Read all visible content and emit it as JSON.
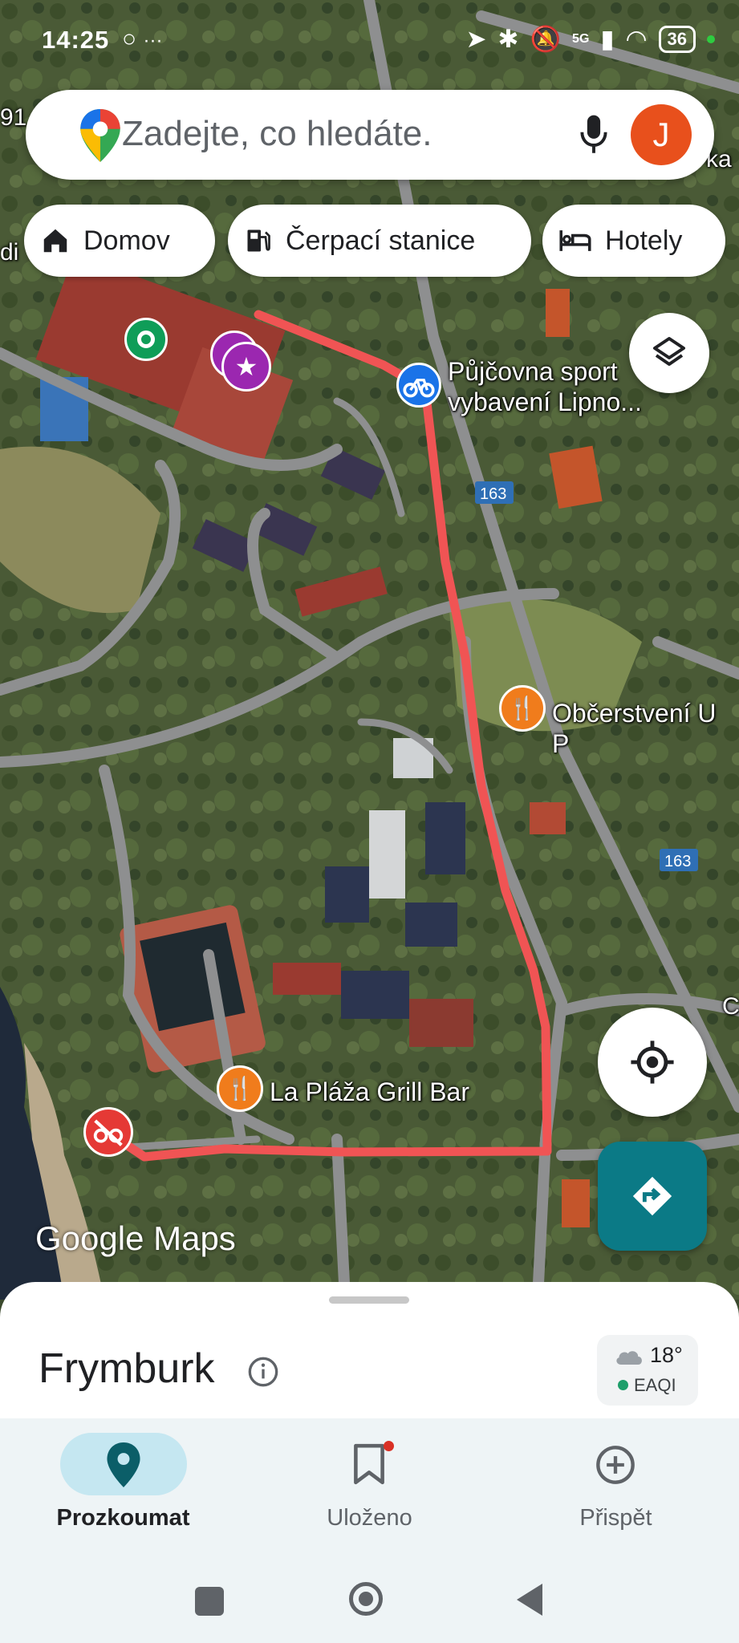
{
  "status_bar": {
    "time": "14:25",
    "battery": "36",
    "network": "5G"
  },
  "search": {
    "placeholder": "Zadejte, co hledáte.",
    "avatar_letter": "J"
  },
  "chips": [
    {
      "label": "Domov",
      "icon": "home-icon"
    },
    {
      "label": "Čerpací stanice",
      "icon": "gas-station-icon"
    },
    {
      "label": "Hotely",
      "icon": "hotel-bed-icon"
    }
  ],
  "map": {
    "labels": {
      "bike_rental": "Půjčovna sportovního vybavení Lipno...",
      "bike_rental_line1": "Půjčovna sport",
      "bike_rental_line2": "vybavení Lipno...",
      "snack": "Občerstvení U P",
      "grill_bar": "La Pláža Grill Bar",
      "road_number": "163",
      "edge_left_top": "91",
      "edge_left_chip": "di",
      "edge_right_top": "ka",
      "edge_right_mid": "C"
    },
    "route_color": "#f05454",
    "watermark": "Google Maps"
  },
  "place": {
    "title": "Frymburk",
    "weather_temp": "18°",
    "air_quality": "EAQI"
  },
  "bottom_nav": [
    {
      "label": "Prozkoumat",
      "icon": "explore-pin-icon",
      "active": true
    },
    {
      "label": "Uloženo",
      "icon": "bookmark-icon",
      "active": false
    },
    {
      "label": "Přispět",
      "icon": "add-circle-icon",
      "active": false
    }
  ]
}
